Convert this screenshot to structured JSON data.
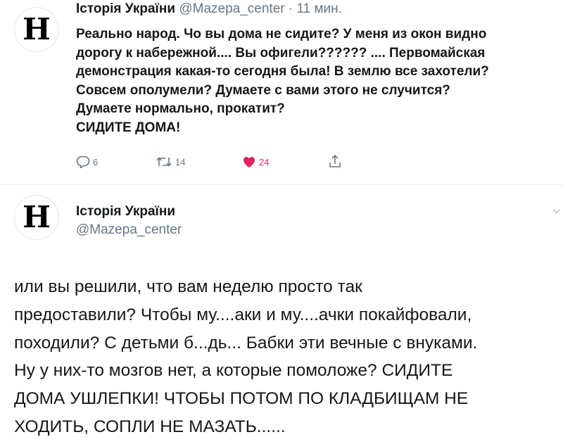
{
  "tweet1": {
    "avatar_letter": "H",
    "name": "Історія України",
    "handle": "@Mazepa_center",
    "separator": "·",
    "time": "11 мин.",
    "lines": [
      "Реально народ. Чо вы дома не сидите? У меня из окон видно",
      "дорогу к набережной.... Вы офигели?????? .... Первомайская",
      "демонстрация какая-то сегодня была! В землю все захотели?",
      "Совсем ополумели? Думаете с вами этого не случится?",
      "Думаете нормально, прокатит?",
      "СИДИТЕ ДОМА!"
    ],
    "actions": {
      "reply_icon": "reply-icon",
      "reply_count": "6",
      "retweet_icon": "retweet-icon",
      "retweet_count": "14",
      "like_icon": "heart-icon",
      "like_count": "24",
      "share_icon": "share-icon"
    },
    "colors": {
      "like": "#e0245e",
      "muted": "#657786"
    }
  },
  "tweet2": {
    "avatar_letter": "H",
    "name": "Історія України",
    "handle": "@Mazepa_center",
    "caret_icon": "chevron-down-icon",
    "lines": [
      "или вы решили, что вам неделю просто так",
      "предоставили? Чтобы му....аки и му....ачки покайфовали,",
      "походили? С детьми б...дь... Бабки эти вечные с внуками.",
      "Ну у них-то мозгов нет, а которые помоложе? СИДИТЕ",
      "ДОМА УШЛЕПКИ! ЧТОБЫ ПОТОМ ПО КЛАДБИЩАМ НЕ",
      "ХОДИТЬ, СОПЛИ НЕ МАЗАТЬ......"
    ]
  }
}
